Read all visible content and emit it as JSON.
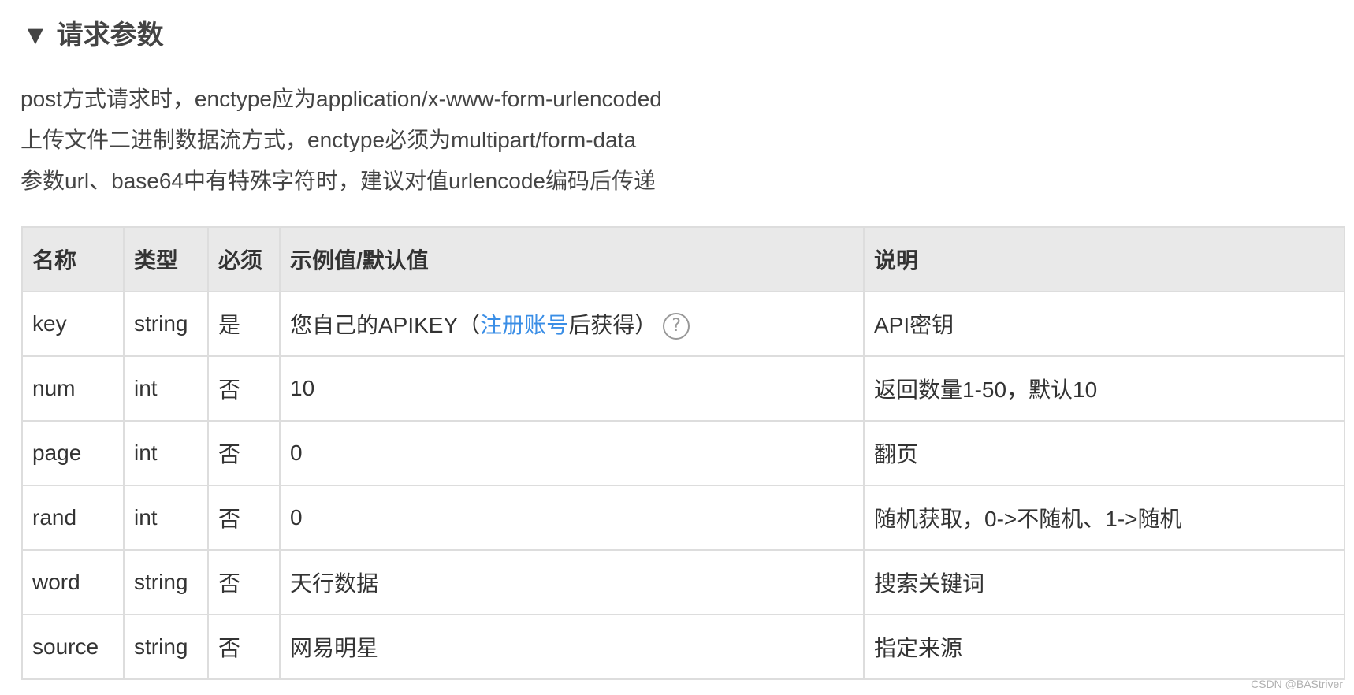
{
  "section": {
    "arrow": "▼",
    "title": "请求参数"
  },
  "notes": [
    "post方式请求时，enctype应为application/x-www-form-urlencoded",
    "上传文件二进制数据流方式，enctype必须为multipart/form-data",
    "参数url、base64中有特殊字符时，建议对值urlencode编码后传递"
  ],
  "table": {
    "headers": {
      "name": "名称",
      "type": "类型",
      "required": "必须",
      "example": "示例值/默认值",
      "description": "说明"
    },
    "rows": [
      {
        "name": "key",
        "type": "string",
        "required": "是",
        "example_prefix": "您自己的APIKEY（",
        "example_link": "注册账号",
        "example_suffix": "后获得）",
        "help_icon": "?",
        "description": "API密钥"
      },
      {
        "name": "num",
        "type": "int",
        "required": "否",
        "example": "10",
        "description": "返回数量1-50，默认10"
      },
      {
        "name": "page",
        "type": "int",
        "required": "否",
        "example": "0",
        "description": "翻页"
      },
      {
        "name": "rand",
        "type": "int",
        "required": "否",
        "example": "0",
        "description": "随机获取，0->不随机、1->随机"
      },
      {
        "name": "word",
        "type": "string",
        "required": "否",
        "example": "天行数据",
        "description": "搜索关键词"
      },
      {
        "name": "source",
        "type": "string",
        "required": "否",
        "example": "网易明星",
        "description": "指定来源"
      }
    ]
  },
  "watermark": "CSDN @BAStriver",
  "colors": {
    "link": "#3a8ee6",
    "header_bg": "#e9e9e9",
    "border": "#dddddd"
  }
}
